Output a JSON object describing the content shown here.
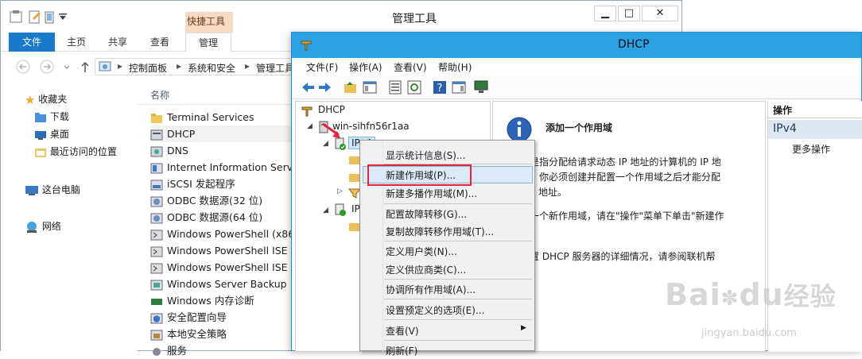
{
  "explorer": {
    "title": "管理工具",
    "context_tab": "快捷工具",
    "tabs": [
      "文件",
      "主页",
      "共享",
      "查看",
      "管理"
    ],
    "breadcrumb": [
      "控制面板",
      "系统和安全",
      "管理工具"
    ],
    "column_name": "名称",
    "nav": [
      {
        "label": "收藏夹",
        "icon": "star-icon"
      },
      {
        "label": "下载",
        "icon": "download-folder-icon"
      },
      {
        "label": "桌面",
        "icon": "desktop-icon"
      },
      {
        "label": "最近访问的位置",
        "icon": "recent-icon"
      },
      {
        "label": "这台电脑",
        "icon": "computer-icon"
      },
      {
        "label": "网络",
        "icon": "network-icon"
      }
    ],
    "files": [
      "Terminal Services",
      "DHCP",
      "DNS",
      "Internet Information Service",
      "iSCSI 发起程序",
      "ODBC 数据源(32 位)",
      "ODBC 数据源(64 位)",
      "Windows PowerShell (x86)",
      "Windows PowerShell ISE (x",
      "Windows PowerShell ISE",
      "Windows Server Backup",
      "Windows 内存诊断",
      "安全配置向导",
      "本地安全策略",
      "服务"
    ]
  },
  "dhcp": {
    "title": "DHCP",
    "menu": [
      "文件(F)",
      "操作(A)",
      "查看(V)",
      "帮助(H)"
    ],
    "tree": {
      "root": "DHCP",
      "server": "win-sihfn56r1aa",
      "ipv4": "IPv4",
      "ipv6": "IP"
    },
    "center": {
      "heading": "添加一个作用域",
      "p1": [
        "是指分配给请求动态 IP 地址的计算机的 IP 地",
        "。你必须创建并配置一个作用域之后才能分配",
        "P 地址。"
      ],
      "p2": "一个新作用域，请在\"操作\"菜单下单击\"新建作",
      "p3": "置 DHCP 服务器的详细情况，请参阅联机帮"
    },
    "actions": {
      "header": "操作",
      "section": "IPv4",
      "more": "更多操作"
    }
  },
  "context_menu": [
    "显示统计信息(S)...",
    "新建作用域(P)...",
    "新建多播作用域(M)...",
    "配置故障转移(G)...",
    "复制故障转移作用域(T)...",
    "定义用户类(N)...",
    "定义供应商类(C)...",
    "协调所有作用域(A)...",
    "设置预定义的选项(E)...",
    "查看(V)",
    "刷新(F)"
  ],
  "watermark": {
    "brand": "Bai",
    "brand2": "du",
    "suffix": "经验",
    "url": "jingyan.baidu.com"
  },
  "colors": {
    "accent": "#1979ca",
    "titlebar": "#2da0e4",
    "highlight": "#e5243b",
    "context_tab": "#f8d9c4"
  }
}
